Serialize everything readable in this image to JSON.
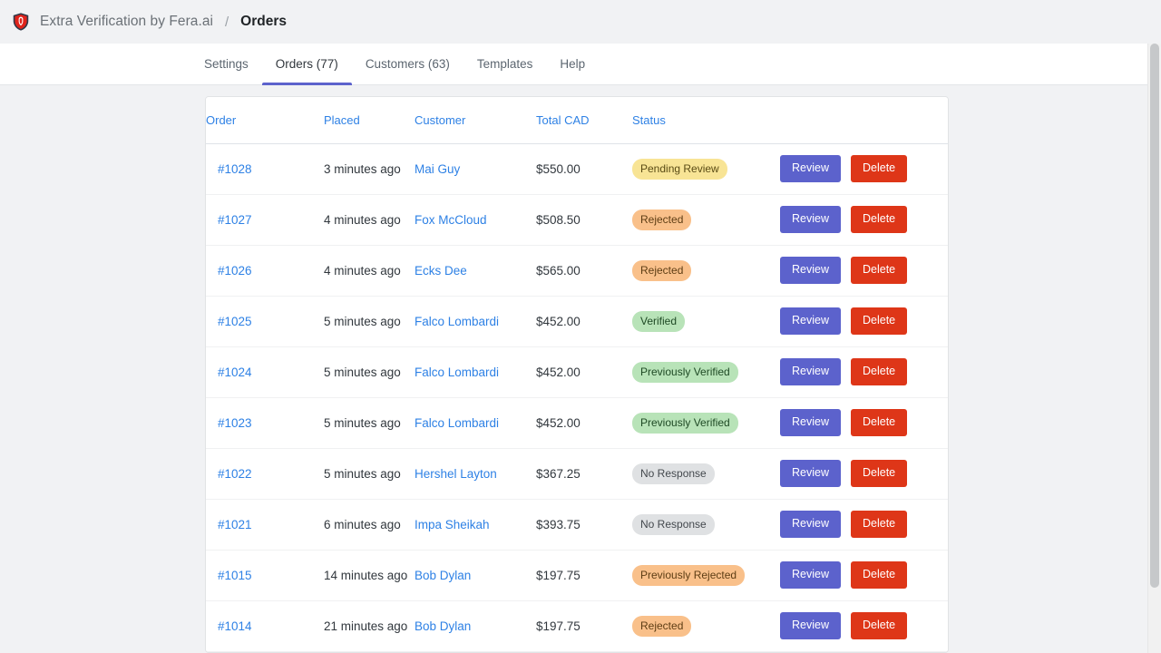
{
  "topbar": {
    "logo_icon": "shield-icon",
    "app_name": "Extra Verification by Fera.ai",
    "separator": "/",
    "current_page": "Orders"
  },
  "nav": {
    "tabs": [
      {
        "label": "Settings",
        "active": false
      },
      {
        "label": "Orders (77)",
        "active": true
      },
      {
        "label": "Customers (63)",
        "active": false
      },
      {
        "label": "Templates",
        "active": false
      },
      {
        "label": "Help",
        "active": false
      }
    ]
  },
  "table": {
    "columns": [
      {
        "label": "Order"
      },
      {
        "label": "Placed"
      },
      {
        "label": "Customer"
      },
      {
        "label": "Total CAD"
      },
      {
        "label": "Status"
      },
      {
        "label": ""
      }
    ],
    "actions": {
      "review_label": "Review",
      "delete_label": "Delete"
    },
    "rows": [
      {
        "order": "#1028",
        "placed": "3 minutes ago",
        "customer": "Mai Guy",
        "total": "$550.00",
        "status": "Pending Review",
        "status_type": "pending"
      },
      {
        "order": "#1027",
        "placed": "4 minutes ago",
        "customer": "Fox McCloud",
        "total": "$508.50",
        "status": "Rejected",
        "status_type": "rejected"
      },
      {
        "order": "#1026",
        "placed": "4 minutes ago",
        "customer": "Ecks Dee",
        "total": "$565.00",
        "status": "Rejected",
        "status_type": "rejected"
      },
      {
        "order": "#1025",
        "placed": "5 minutes ago",
        "customer": "Falco Lombardi",
        "total": "$452.00",
        "status": "Verified",
        "status_type": "verified"
      },
      {
        "order": "#1024",
        "placed": "5 minutes ago",
        "customer": "Falco Lombardi",
        "total": "$452.00",
        "status": "Previously Verified",
        "status_type": "verified"
      },
      {
        "order": "#1023",
        "placed": "5 minutes ago",
        "customer": "Falco Lombardi",
        "total": "$452.00",
        "status": "Previously Verified",
        "status_type": "verified"
      },
      {
        "order": "#1022",
        "placed": "5 minutes ago",
        "customer": "Hershel Layton",
        "total": "$367.25",
        "status": "No Response",
        "status_type": "noresp"
      },
      {
        "order": "#1021",
        "placed": "6 minutes ago",
        "customer": "Impa Sheikah",
        "total": "$393.75",
        "status": "No Response",
        "status_type": "noresp"
      },
      {
        "order": "#1015",
        "placed": "14 minutes ago",
        "customer": "Bob Dylan",
        "total": "$197.75",
        "status": "Previously Rejected",
        "status_type": "rejected"
      },
      {
        "order": "#1014",
        "placed": "21 minutes ago",
        "customer": "Bob Dylan",
        "total": "$197.75",
        "status": "Rejected",
        "status_type": "rejected"
      }
    ]
  },
  "colors": {
    "accent": "#5c62cc",
    "link": "#2e81e5",
    "danger": "#de3618",
    "badge_pending": "#f8e495",
    "badge_rejected": "#f9c08a",
    "badge_verified": "#b8e3b8",
    "badge_noresp": "#dfe1e3"
  }
}
